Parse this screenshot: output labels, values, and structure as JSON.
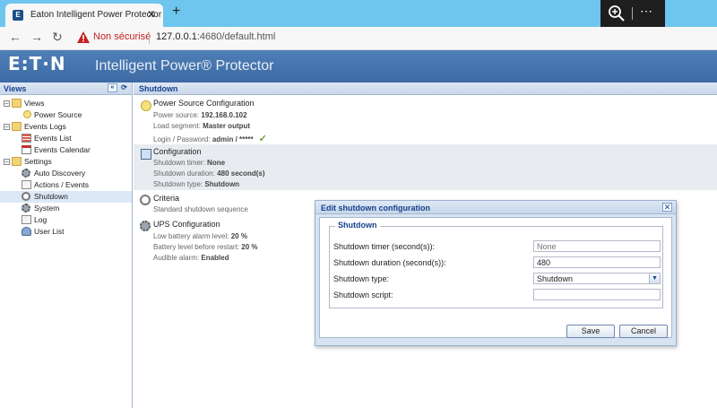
{
  "browser": {
    "tab_title": "Eaton Intelligent Power Protector",
    "favicon_letter": "E",
    "not_secure_label": "Non sécurisé",
    "url_host": "127.0.0.1",
    "url_rest": ":4680/default.html"
  },
  "app": {
    "logo": "E:T·N",
    "title": "Intelligent Power® Protector"
  },
  "sidebar": {
    "header": "Views",
    "items": [
      {
        "label": "Views",
        "icon": "folder-icon"
      },
      {
        "label": "Power Source",
        "icon": "bulb-icon"
      },
      {
        "label": "Events Logs",
        "icon": "folder-icon"
      },
      {
        "label": "Events List",
        "icon": "list-icon"
      },
      {
        "label": "Events Calendar",
        "icon": "calendar-icon"
      },
      {
        "label": "Settings",
        "icon": "folder-icon"
      },
      {
        "label": "Auto Discovery",
        "icon": "gear-icon"
      },
      {
        "label": "Actions / Events",
        "icon": "page-icon"
      },
      {
        "label": "Shutdown",
        "icon": "power-icon"
      },
      {
        "label": "System",
        "icon": "gear-icon"
      },
      {
        "label": "Log",
        "icon": "page-icon"
      },
      {
        "label": "User List",
        "icon": "user-icon"
      }
    ]
  },
  "main": {
    "header": "Shutdown",
    "sections": {
      "power_source": {
        "title": "Power Source Configuration",
        "line1_label": "Power source:",
        "line1_value": "192.168.0.102",
        "line2_label": "Load segment:",
        "line2_value": "Master output",
        "line3_label": "Login / Password:",
        "line3_value": "admin / *****"
      },
      "configuration": {
        "title": "Configuration",
        "line1_label": "Shutdown timer:",
        "line1_value": "None",
        "line2_label": "Shutdown duration:",
        "line2_value": "480 second(s)",
        "line3_label": "Shutdown type:",
        "line3_value": "Shutdown"
      },
      "criteria": {
        "title": "Criteria",
        "line1": "Standard shutdown sequence"
      },
      "ups": {
        "title": "UPS Configuration",
        "line1_label": "Low battery alarm level:",
        "line1_value": "20 %",
        "line2_label": "Battery level before restart:",
        "line2_value": "20 %",
        "line3_label": "Audible alarm:",
        "line3_value": "Enabled"
      }
    }
  },
  "modal": {
    "title": "Edit shutdown configuration",
    "fieldset_legend": "Shutdown",
    "fields": {
      "timer_label": "Shutdown timer (second(s)):",
      "timer_placeholder": "None",
      "duration_label": "Shutdown duration (second(s)):",
      "duration_value": "480",
      "type_label": "Shutdown type:",
      "type_value": "Shutdown",
      "script_label": "Shutdown script:",
      "script_value": ""
    },
    "save_label": "Save",
    "cancel_label": "Cancel"
  }
}
